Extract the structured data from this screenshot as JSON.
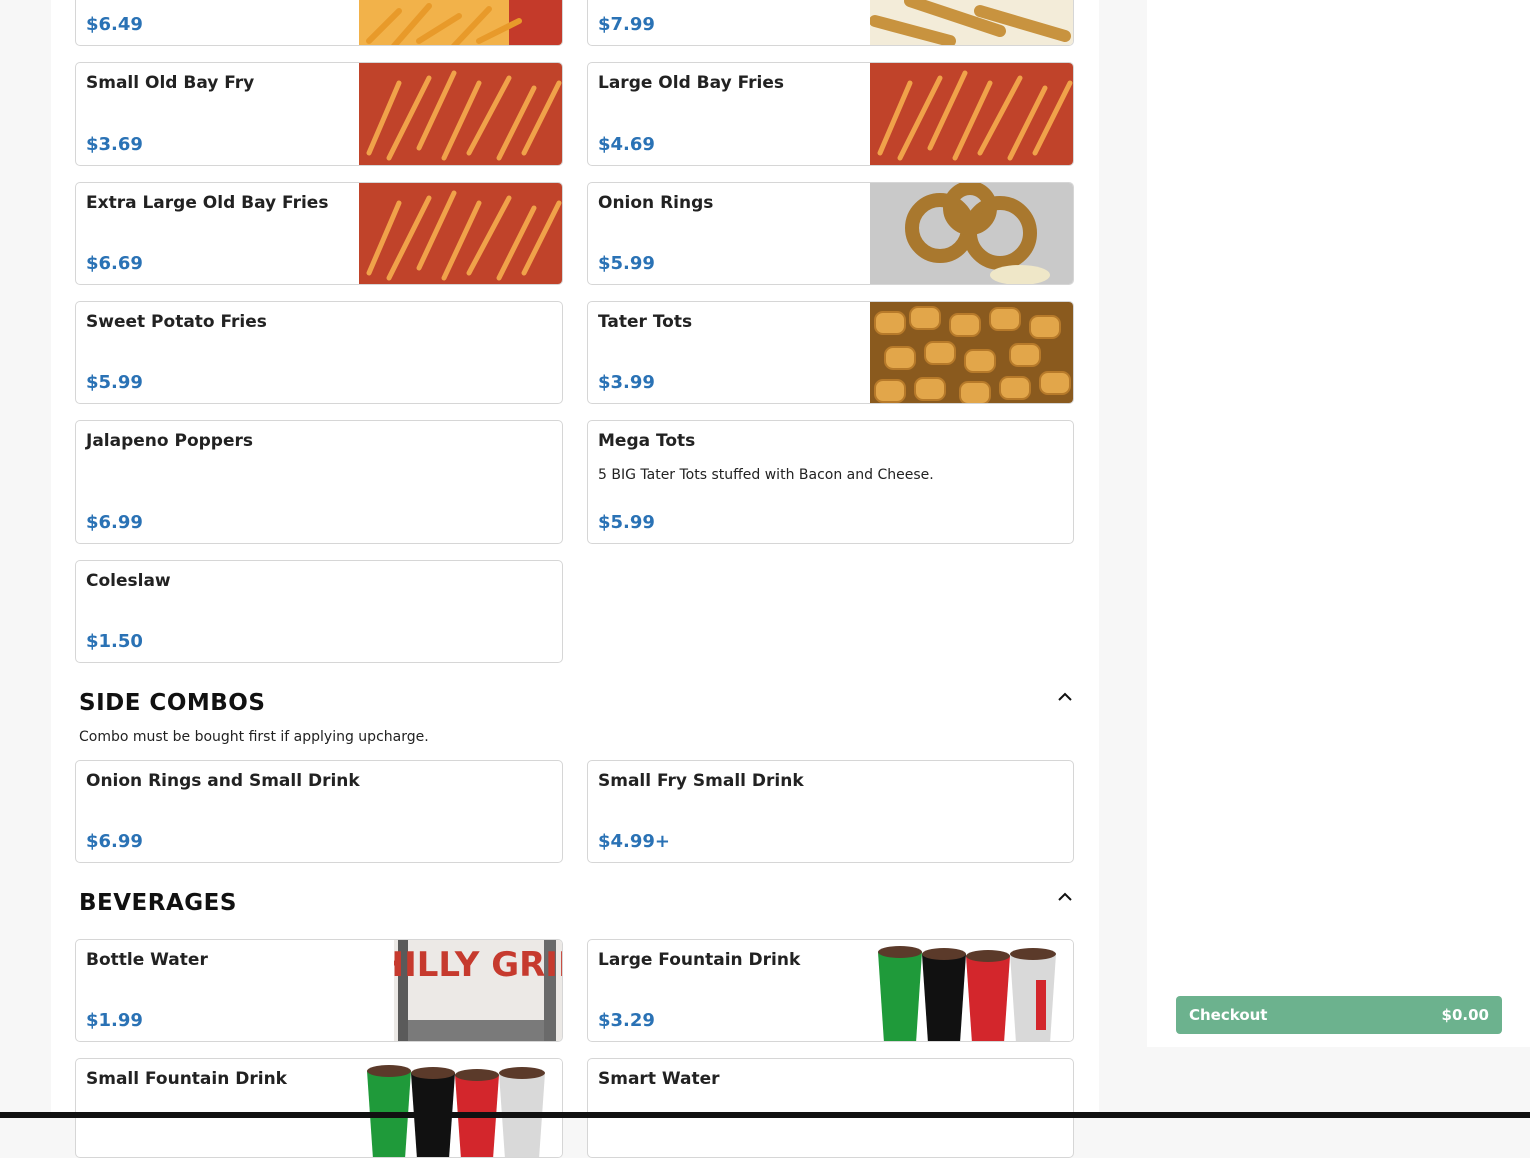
{
  "colors": {
    "price": "#2a72b5",
    "checkout_bg": "#6cb28e",
    "card_border": "#d6d6d6"
  },
  "items_top": [
    {
      "price": "$6.49",
      "image": "fries-photo"
    },
    {
      "price": "$7.99",
      "image": "breaded-sticks-photo"
    }
  ],
  "items": [
    {
      "name": "Small Old Bay Fry",
      "price": "$3.69",
      "image": "old-bay-fries-photo"
    },
    {
      "name": "Large Old Bay Fries",
      "price": "$4.69",
      "image": "old-bay-fries-photo"
    },
    {
      "name": "Extra Large Old Bay Fries",
      "price": "$6.69",
      "image": "old-bay-fries-photo"
    },
    {
      "name": "Onion Rings",
      "price": "$5.99",
      "image": "onion-rings-photo"
    },
    {
      "name": "Sweet Potato Fries",
      "price": "$5.99"
    },
    {
      "name": "Tater Tots",
      "price": "$3.99",
      "image": "tater-tots-photo"
    },
    {
      "name": "Jalapeno Poppers",
      "price": "$6.99"
    },
    {
      "name": "Mega Tots",
      "description": "5 BIG Tater Tots stuffed with Bacon and Cheese.",
      "price": "$5.99"
    },
    {
      "name": "Coleslaw",
      "price": "$1.50"
    }
  ],
  "side_combos": {
    "title": "SIDE COMBOS",
    "note": "Combo must be bought first if applying upcharge.",
    "items": [
      {
        "name": "Onion Rings and Small Drink",
        "price": "$6.99"
      },
      {
        "name": "Small Fry Small Drink",
        "price": "$4.99+"
      }
    ]
  },
  "beverages": {
    "title": "BEVERAGES",
    "items": [
      {
        "name": "Bottle Water",
        "price": "$1.99",
        "image": "philly-grill-bottle-photo",
        "image_text": "PHILLY GRILL"
      },
      {
        "name": "Large Fountain Drink",
        "price": "$3.29",
        "image": "fountain-drinks-photo"
      },
      {
        "name": "Small Fountain Drink",
        "image": "fountain-drinks-photo"
      },
      {
        "name": "Smart Water"
      }
    ]
  },
  "checkout": {
    "label": "Checkout",
    "amount": "$0.00"
  }
}
